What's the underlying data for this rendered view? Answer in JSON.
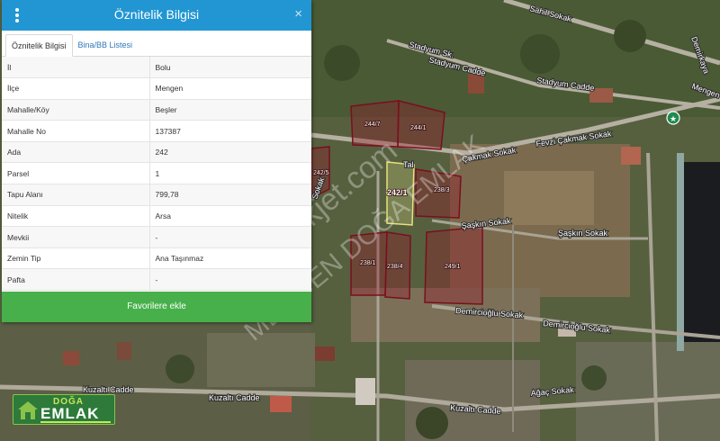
{
  "panel": {
    "title": "Öznitelik Bilgisi",
    "menu_icon": "vertical-dots-icon",
    "close_icon": "close-icon",
    "close_glyph": "×",
    "tabs": [
      {
        "label": "Öznitelik Bilgisi",
        "active": true
      },
      {
        "label": "Bina/BB Listesi",
        "active": false
      }
    ],
    "rows": [
      {
        "key": "İl",
        "value": "Bolu"
      },
      {
        "key": "İlçe",
        "value": "Mengen"
      },
      {
        "key": "Mahalle/Köy",
        "value": "Beşler"
      },
      {
        "key": "Mahalle No",
        "value": "137387"
      },
      {
        "key": "Ada",
        "value": "242"
      },
      {
        "key": "Parsel",
        "value": "1"
      },
      {
        "key": "Tapu Alanı",
        "value": "799,78"
      },
      {
        "key": "Nitelik",
        "value": "Arsa"
      },
      {
        "key": "Mevkii",
        "value": "-"
      },
      {
        "key": "Zemin Tip",
        "value": "Ana Taşınmaz"
      },
      {
        "key": "Pafta",
        "value": "-"
      }
    ],
    "favorite_button": "Favorilere ekle",
    "colors": {
      "header": "#2196d3",
      "button": "#47b04b"
    }
  },
  "map": {
    "street_labels": [
      "Sahil Sokak",
      "Stadyum Sk.",
      "Stadyum Cadde",
      "Stadyum Cadde",
      "Mengen",
      "Fevzi Çakmak Sokak",
      "Çakmak Sokak",
      "Şaşkın Sokak",
      "Şaşkın Sokak",
      "Demircioğlu Sokak",
      "Demircioğlu Sokak",
      "Kuzaltı Cadde",
      "Kuzaltı Cadde",
      "Kuzaltı Cadde",
      "Ağaç Sokak",
      "Demirkaya",
      "Sokak",
      "Tal"
    ],
    "parcel_labels": [
      "244/7",
      "244/1",
      "242/1",
      "238/1",
      "238/4",
      "238/3",
      "249/1",
      "242/5"
    ],
    "watermark": [
      "emlakjet.com",
      "MENGEN DOĞA EMLAK"
    ],
    "poi_icon": "green-circle-star-icon"
  },
  "logo": {
    "brand_top": "DOĞA",
    "brand_main": "EMLAK",
    "icon": "green-house-icon"
  }
}
